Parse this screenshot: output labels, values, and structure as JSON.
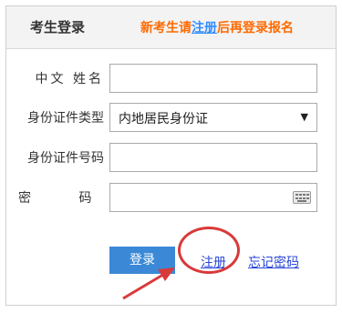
{
  "header": {
    "title": "考生登录",
    "notice_prefix": "新考生请",
    "notice_link": "注册",
    "notice_suffix": "后再登录报名"
  },
  "form": {
    "name_label": "中文 姓名",
    "name_value": "",
    "id_type_label": "身份证件类型",
    "id_type_selected": "内地居民身份证",
    "id_number_label": "身份证件号码",
    "id_number_value": "",
    "password_label": "密 码",
    "password_value": ""
  },
  "actions": {
    "login_label": "登录",
    "register_label": "注册",
    "forgot_label": "忘记密码"
  },
  "colors": {
    "notice_orange": "#ff6a00",
    "link_blue": "#2f8cff",
    "button_blue": "#3b89d6",
    "annotation_red": "#d83a3a"
  }
}
